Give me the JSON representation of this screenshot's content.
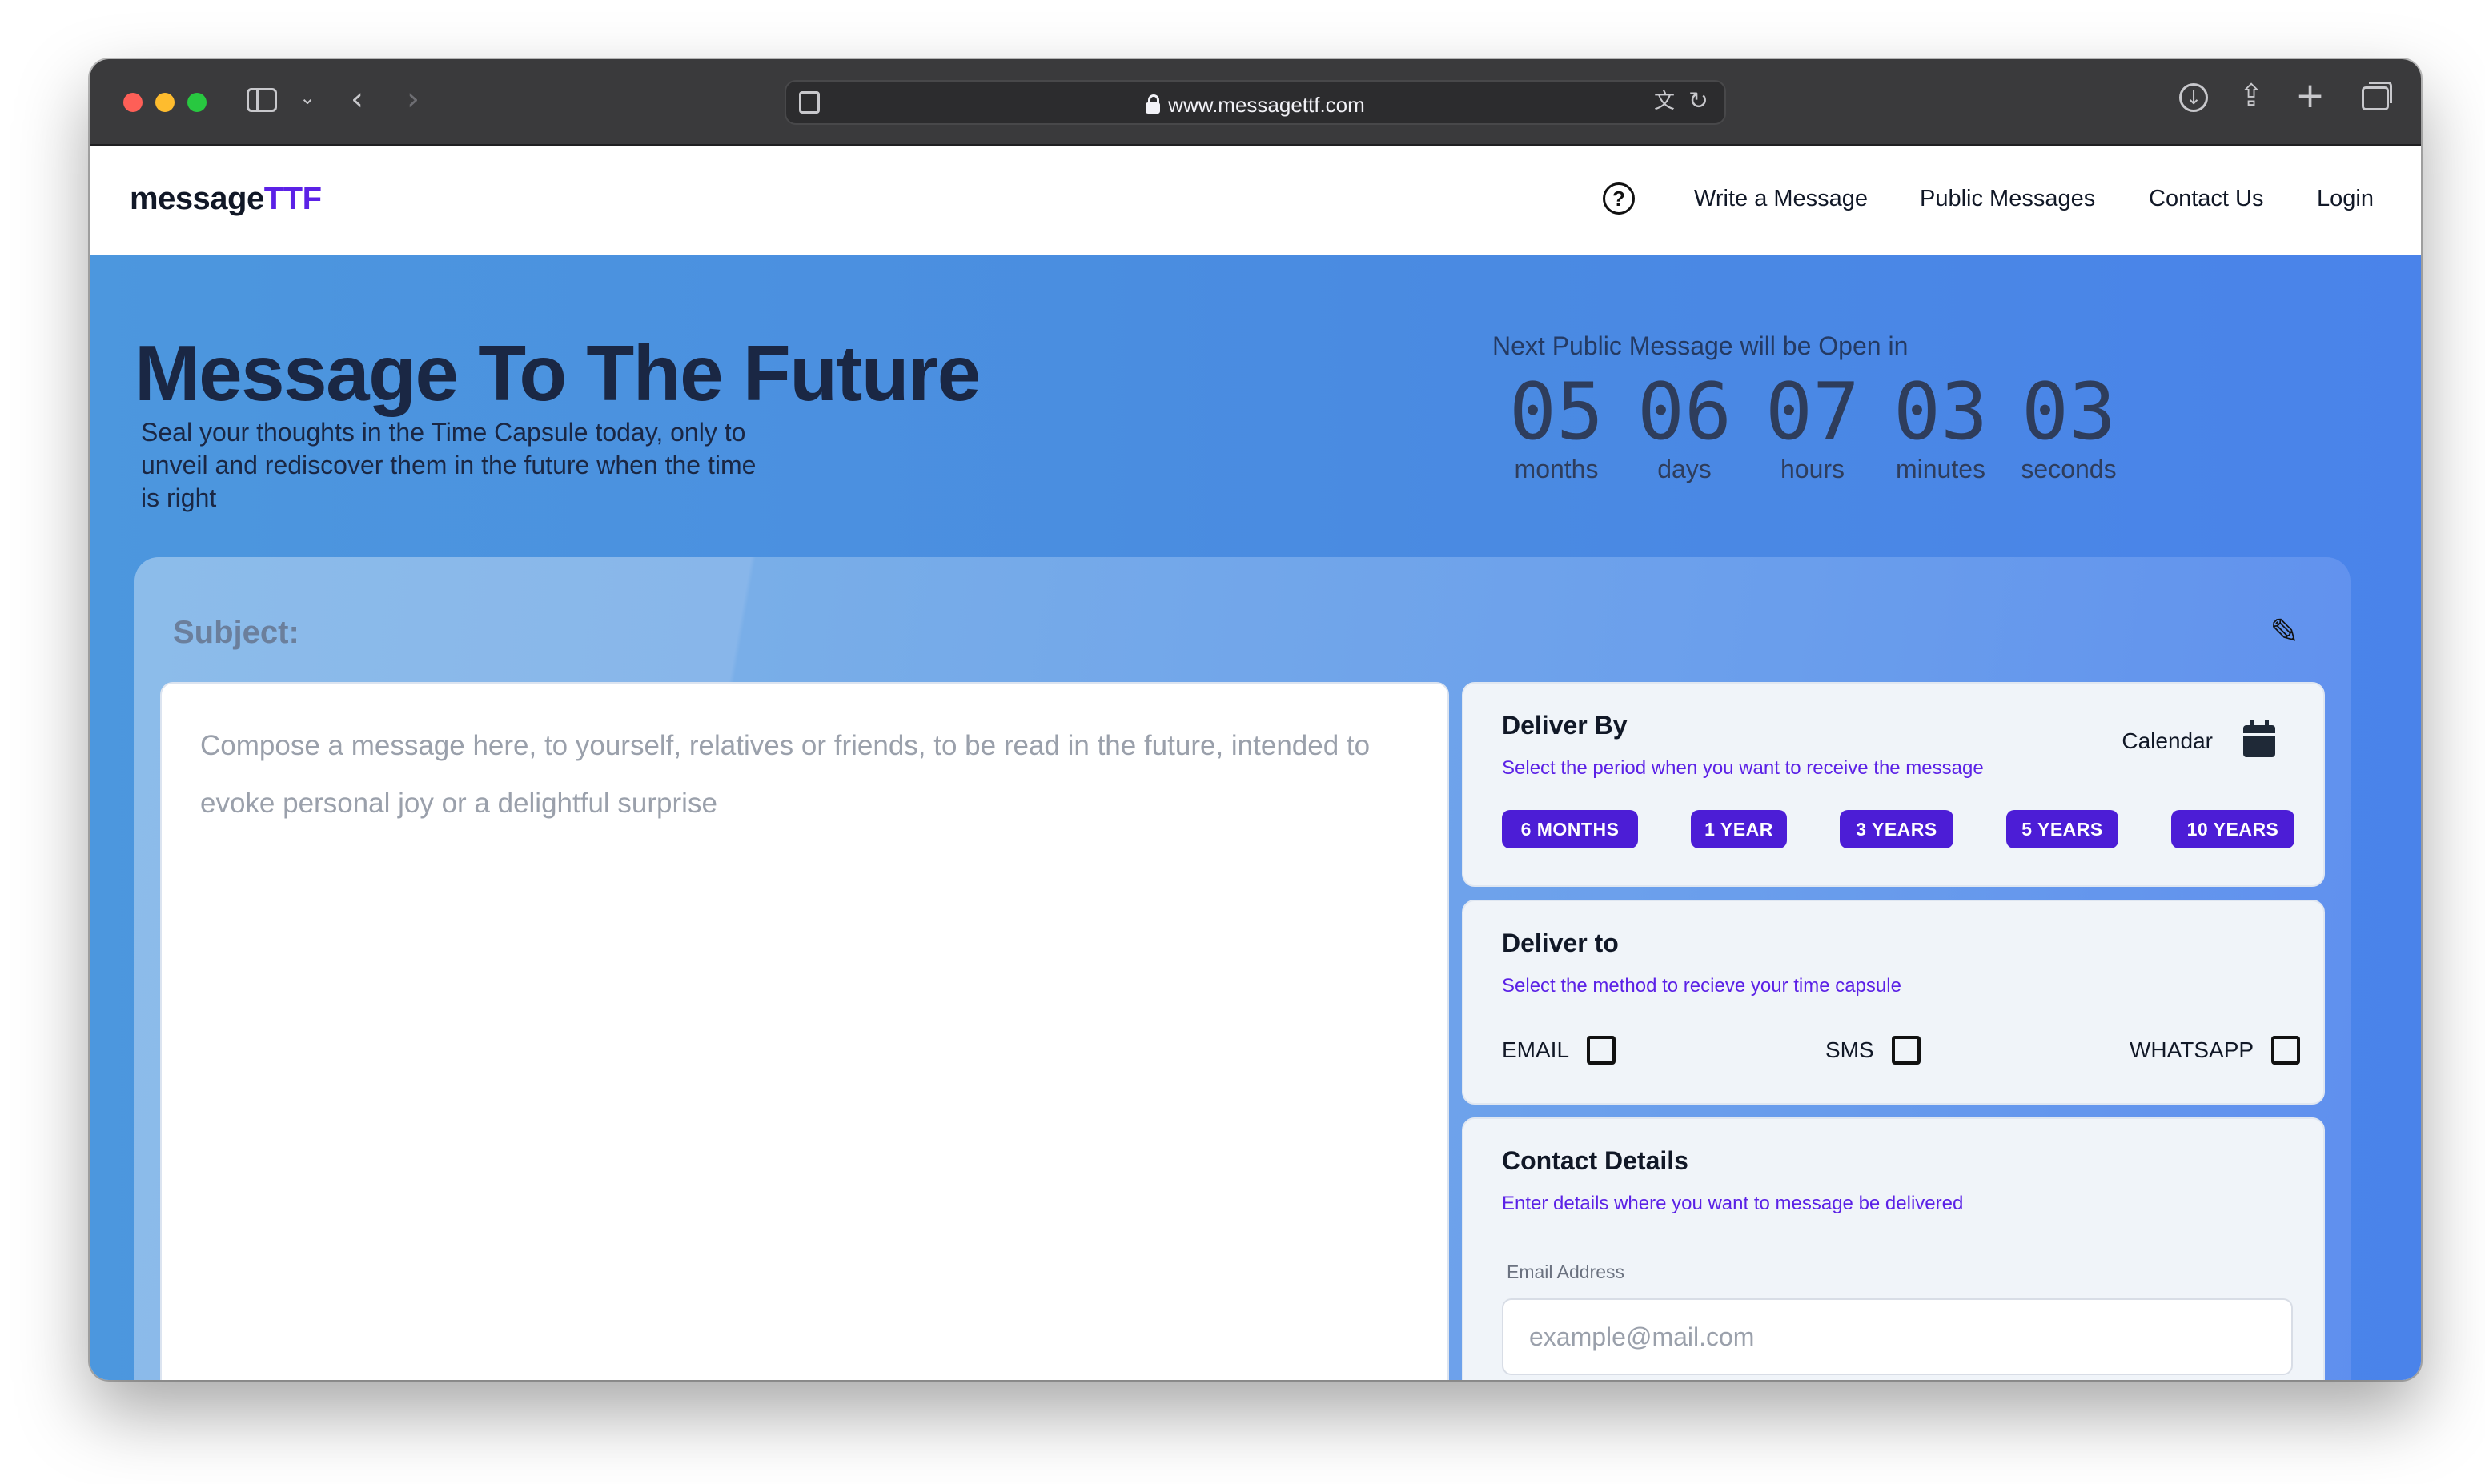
{
  "browser": {
    "url": "www.messagettf.com"
  },
  "header": {
    "logo_main": "message",
    "logo_accent": "TTF",
    "nav": [
      "Write a Message",
      "Public Messages",
      "Contact Us",
      "Login"
    ]
  },
  "hero": {
    "title": "Message To The Future",
    "subtitle": "Seal your thoughts in the Time Capsule today, only to unveil and rediscover them in the future when the time is right",
    "countdown_label": "Next Public Message will be Open in",
    "countdown": [
      {
        "value": "05",
        "label": "months"
      },
      {
        "value": "06",
        "label": "days"
      },
      {
        "value": "07",
        "label": "hours"
      },
      {
        "value": "03",
        "label": "minutes"
      },
      {
        "value": "03",
        "label": "seconds"
      }
    ]
  },
  "form": {
    "subject_label": "Subject:",
    "compose_placeholder": "Compose a message here, to yourself, relatives or friends,  to be read in the future, intended to evoke personal joy or a delightful surprise",
    "deliver_by": {
      "title": "Deliver By",
      "description": "Select the period when you want to receive the message",
      "calendar_label": "Calendar",
      "periods": [
        "6 MONTHS",
        "1 YEAR",
        "3 YEARS",
        "5 YEARS",
        "10 YEARS"
      ]
    },
    "deliver_to": {
      "title": "Deliver to",
      "description": "Select the method to recieve your time capsule",
      "methods": [
        "EMAIL",
        "SMS",
        "WHATSAPP"
      ]
    },
    "contact": {
      "title": "Contact Details",
      "description": "Enter details where you want to message be delivered",
      "email_label": "Email Address",
      "email_placeholder": "example@mail.com"
    }
  },
  "colors": {
    "accent": "#5b21e6",
    "button": "#4c1dd6",
    "hero_bg": "#4a8be1"
  }
}
